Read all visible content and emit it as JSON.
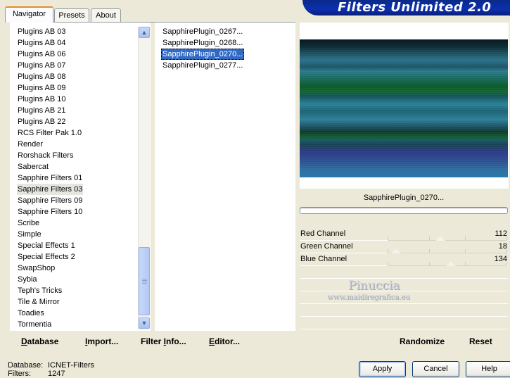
{
  "tabs": [
    {
      "label": "Navigator",
      "active": true
    },
    {
      "label": "Presets",
      "active": false
    },
    {
      "label": "About",
      "active": false
    }
  ],
  "app_title": "Filters Unlimited 2.0",
  "categories": [
    "Plugins AB 03",
    "Plugins AB 04",
    "Plugins AB 06",
    "Plugins AB 07",
    "Plugins AB 08",
    "Plugins AB 09",
    "Plugins AB 10",
    "Plugins AB 21",
    "Plugins AB 22",
    "RCS Filter Pak 1.0",
    "Render",
    "Rorshack Filters",
    "Sabercat",
    "Sapphire Filters 01",
    "Sapphire Filters 03",
    "Sapphire Filters 09",
    "Sapphire Filters 10",
    "Scribe",
    "Simple",
    "Special Effects 1",
    "Special Effects 2",
    "SwapShop",
    "Sybia",
    "Teph's Tricks",
    "Tile & Mirror",
    "Toadies",
    "Tormentia"
  ],
  "selected_category": "Sapphire Filters 03",
  "filters": [
    "SapphirePlugin_0267...",
    "SapphirePlugin_0268...",
    "SapphirePlugin_0270...",
    "SapphirePlugin_0277..."
  ],
  "selected_filter": "SapphirePlugin_0270...",
  "preview_filter_name": "SapphirePlugin_0270...",
  "controls": [
    {
      "label": "Red Channel",
      "value": "112",
      "level": 0.44
    },
    {
      "label": "Green Channel",
      "value": "18",
      "level": 0.07
    },
    {
      "label": "Blue Channel",
      "value": "134",
      "level": 0.53
    }
  ],
  "watermark": {
    "name": "Pinuccia",
    "site": "www.maidiregrafica.eu"
  },
  "toolbar": {
    "database": {
      "u": "D",
      "rest": "atabase"
    },
    "import": {
      "u": "I",
      "rest": "mport..."
    },
    "filter_info": {
      "pre": "Filter ",
      "u": "I",
      "rest": "nfo..."
    },
    "editor": {
      "u": "E",
      "rest": "ditor..."
    },
    "randomize": "Randomize",
    "reset": "Reset"
  },
  "status": {
    "database_label": "Database:",
    "database_value": "ICNET-Filters",
    "filters_label": "Filters:",
    "filters_value": "1247"
  },
  "buttons": {
    "apply": "Apply",
    "cancel": "Cancel",
    "help": "Help"
  },
  "colors": {
    "selection": "#316ac5",
    "tab_accent": "#e68b2c",
    "banner": "#0c2fb0"
  }
}
